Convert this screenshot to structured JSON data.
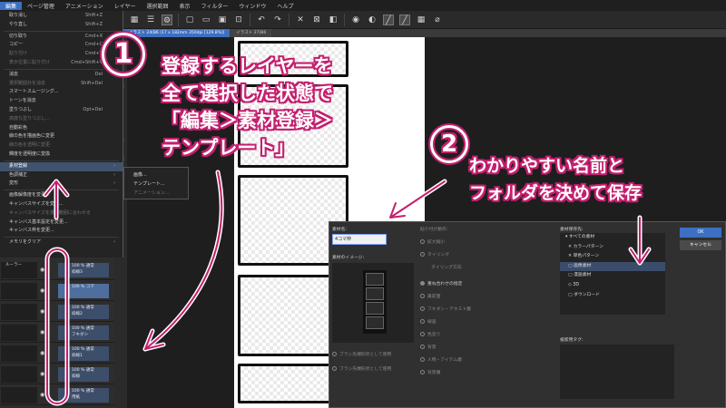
{
  "menubar": {
    "items": [
      "編集",
      "ページ管理",
      "アニメーション",
      "レイヤー",
      "選択範囲",
      "表示",
      "フィルター",
      "ウィンドウ",
      "ヘルプ"
    ]
  },
  "tabs": [
    "イラスト 24(B6 (17 x 182mm 350dpi [129.8%])",
    "イラスト 27(B6"
  ],
  "edit_menu": {
    "items": [
      {
        "label": "取り消し",
        "shortcut": "Shift+Z",
        "dim": false
      },
      {
        "label": "やり直し",
        "shortcut": "Shift+Z",
        "dim": false
      },
      {
        "sep": true
      },
      {
        "label": "切り取り",
        "shortcut": "Cmd+X",
        "dim": false
      },
      {
        "label": "コピー",
        "shortcut": "Cmd+C",
        "dim": false
      },
      {
        "label": "貼り付け",
        "shortcut": "Cmd+V",
        "dim": true
      },
      {
        "label": "表示位置に貼り付け",
        "shortcut": "Cmd+Shift+V",
        "dim": true
      },
      {
        "sep": true
      },
      {
        "label": "消去",
        "shortcut": "Del",
        "dim": false
      },
      {
        "label": "選択範囲外を消去",
        "shortcut": "Shift+Del",
        "dim": true
      },
      {
        "label": "スマートスムージング...",
        "shortcut": "",
        "dim": false
      },
      {
        "label": "トーンを消去",
        "shortcut": "",
        "dim": false
      },
      {
        "label": "塗りつぶし",
        "shortcut": "Opt+Del",
        "dim": false
      },
      {
        "label": "高度な塗りつぶし...",
        "shortcut": "",
        "dim": true
      },
      {
        "label": "自動彩色",
        "shortcut": "",
        "dim": false
      },
      {
        "label": "線の色を描画色に変更",
        "shortcut": "",
        "dim": false
      },
      {
        "label": "線の色を透明に変更",
        "shortcut": "",
        "dim": true
      },
      {
        "label": "輝度を透明度に変換",
        "shortcut": "",
        "dim": false
      },
      {
        "sep": true
      },
      {
        "label": "素材登録",
        "shortcut": "",
        "dim": false,
        "highlight": true,
        "submenu": true
      },
      {
        "label": "色調補正",
        "shortcut": "",
        "dim": false,
        "submenu": true
      },
      {
        "label": "変形",
        "shortcut": "",
        "dim": false,
        "submenu": true
      },
      {
        "sep": true
      },
      {
        "label": "画像解像度を変更...",
        "shortcut": "",
        "dim": false
      },
      {
        "label": "キャンバスサイズを変更...",
        "shortcut": "",
        "dim": false
      },
      {
        "label": "キャンバスサイズを選択範囲に合わせる",
        "shortcut": "",
        "dim": true
      },
      {
        "label": "キャンバス基本設定を変更...",
        "shortcut": "",
        "dim": false
      },
      {
        "label": "キャンバス枠を変更...",
        "shortcut": "",
        "dim": false
      },
      {
        "sep": true
      },
      {
        "label": "メモリをクリア",
        "shortcut": "",
        "dim": false,
        "submenu": true
      }
    ]
  },
  "submenu": {
    "items": [
      {
        "label": "画像...",
        "dim": false
      },
      {
        "label": "テンプレート...",
        "dim": false
      },
      {
        "label": "アニメーション...",
        "dim": true
      }
    ]
  },
  "layers": [
    {
      "name": "ルーラー",
      "mode": "100 % 通常",
      "sub": "枠線3"
    },
    {
      "name": "",
      "mode": "100 % コマ",
      "sub": "",
      "selected": true
    },
    {
      "name": "",
      "mode": "100 % 通常",
      "sub": "枠線2"
    },
    {
      "name": "",
      "mode": "100 % 通常",
      "sub": "フキダシ"
    },
    {
      "name": "",
      "mode": "100 % 通常",
      "sub": "枠線1"
    },
    {
      "name": "",
      "mode": "100 % 通常",
      "sub": "枠線"
    },
    {
      "name": "",
      "mode": "100 % 通常",
      "sub": "用紙"
    }
  ],
  "dialog": {
    "title": "素材名:",
    "name_value": "4コマ枠",
    "image_label": "素材のイメージ:",
    "paste_label": "貼り付け動作:",
    "paste_options": [
      "拡大縮小",
      "タイリング",
      "タイリング方向"
    ],
    "position_label": "重ね合わせの指定",
    "position_options": [
      "最前面",
      "フキダシ・テキスト層",
      "線画",
      "色塗り",
      "背景",
      "人物・アイテム層",
      "背景層"
    ],
    "path_label": "素材保存先:",
    "tree": [
      "すべての素材",
      "カラーパターン",
      "単色パターン",
      "画像素材",
      "漫画素材",
      "3D",
      "ダウンロード"
    ],
    "tag_label": "検索用タグ:",
    "ok_label": "OK",
    "cancel_label": "キャンセル",
    "bottom_options": [
      "ブラシ先端形状として使用",
      "ブラシ先端形状として使用"
    ]
  },
  "annotations": {
    "num1": "①",
    "num2": "②",
    "text1_line1": "登録するレイヤーを",
    "text1_line2": "全て選択した状態で",
    "text1_line3": "「編集＞素材登録＞",
    "text1_line4": "テンプレート」",
    "text2_line1": "わかりやすい名前と",
    "text2_line2": "フォルダを決めて保存"
  },
  "colors": {
    "accent": "#3d6fc2",
    "annotation": "#c41f6e"
  }
}
